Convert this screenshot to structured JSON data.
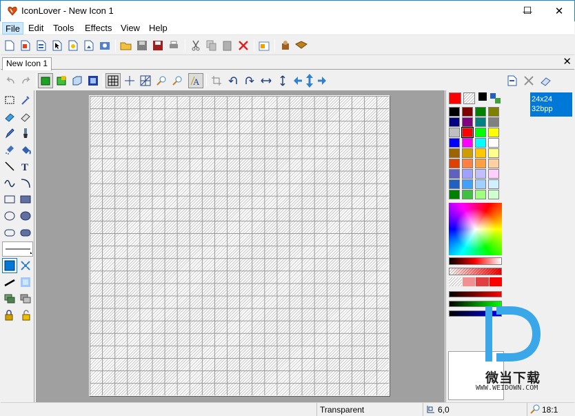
{
  "window": {
    "title": "IconLover - New Icon 1",
    "minimize_glyph": "—",
    "maximize_glyph": "☐",
    "close_glyph": "✕"
  },
  "menu": [
    "File",
    "Edit",
    "Tools",
    "Effects",
    "View",
    "Help"
  ],
  "document_tab": {
    "label": "New Icon 1",
    "close_glyph": "✕"
  },
  "image_list": {
    "selected_item": {
      "size": "24x24",
      "depth": "32bpp"
    }
  },
  "status": {
    "mode": "Transparent",
    "cursor_position": "6,0",
    "zoom": "18:1"
  },
  "watermark": {
    "text": "微当下载",
    "url": "WWW.WEIDOWN.COM"
  },
  "colors": {
    "accent": "#0078d7",
    "canvas_bg": "#a0a0a0",
    "fg_color": "#ff0000"
  },
  "palette_swatches": [
    [
      "#000000",
      "#800000",
      "#008000",
      "#808000"
    ],
    [
      "#000080",
      "#800080",
      "#008080",
      "#808080"
    ],
    [
      "#c0c0c0",
      "#ff0000",
      "#00ff00",
      "#ffff00"
    ],
    [
      "#0000ff",
      "#ff00ff",
      "#00ffff",
      "#ffffff"
    ],
    [
      "#9c6400",
      "#d09c00",
      "#ffc800",
      "#ffff8c"
    ],
    [
      "#e04000",
      "#ff8040",
      "#ffa040",
      "#ffd0a0"
    ],
    [
      "#6060c0",
      "#a0a0ff",
      "#c0c0ff",
      "#ffd0ff"
    ],
    [
      "#2060c0",
      "#40a0ff",
      "#a0d0ff",
      "#d0f0ff"
    ],
    [
      "#008000",
      "#40c040",
      "#a0ff80",
      "#d0ffd0"
    ]
  ]
}
